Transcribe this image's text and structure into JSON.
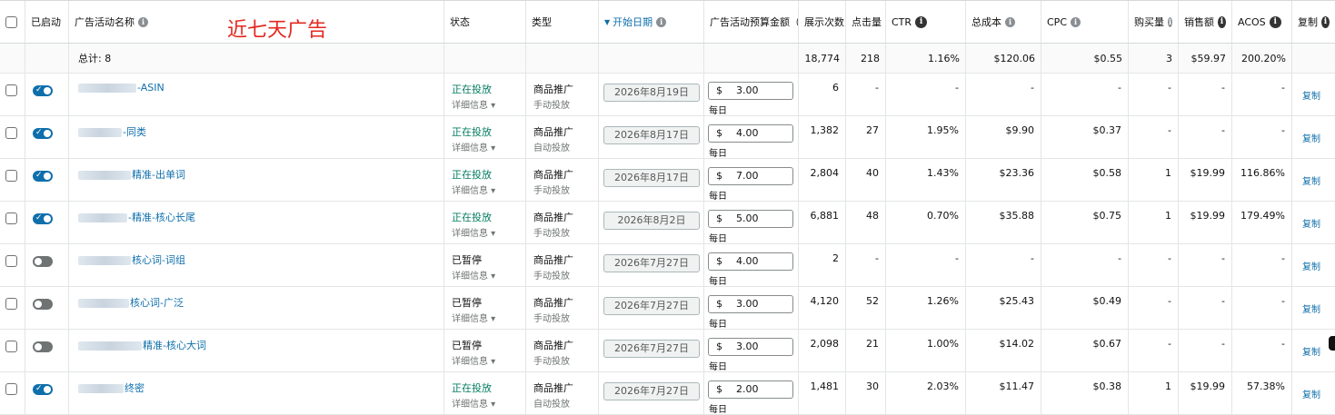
{
  "header": {
    "enabled": "已启动",
    "name": "广告活动名称",
    "status": "状态",
    "type": "类型",
    "start_date": "开始日期",
    "budget": "广告活动预算金额（",
    "impressions": "展示次数",
    "clicks": "点击量（",
    "ctr": "CTR",
    "cost": "总成本",
    "cpc": "CPC",
    "purchases": "购买量",
    "sales": "销售额",
    "acos": "ACOS",
    "copy": "复制"
  },
  "annotation": "近七天广告",
  "totals": {
    "label": "总计: 8",
    "impressions": "18,774",
    "clicks": "218",
    "ctr": "1.16%",
    "cost": "$120.06",
    "cpc": "$0.55",
    "purchases": "3",
    "sales": "$59.97",
    "acos": "200.20%"
  },
  "detail_label": "详细信息",
  "budget_currency": "$",
  "budget_period": "每日",
  "rows": [
    {
      "enabled": true,
      "name": "-ASIN",
      "status": "正在投放",
      "type": "商品推广",
      "targeting": "手动投放",
      "date": "2026年8月19日",
      "budget": "3.00",
      "impressions": "6",
      "clicks": "-",
      "ctr": "-",
      "cost": "-",
      "cpc": "-",
      "purchases": "-",
      "sales": "-",
      "acos": "-",
      "copy": "复制"
    },
    {
      "enabled": true,
      "name": "-同类",
      "status": "正在投放",
      "type": "商品推广",
      "targeting": "自动投放",
      "date": "2026年8月17日",
      "budget": "4.00",
      "impressions": "1,382",
      "clicks": "27",
      "ctr": "1.95%",
      "cost": "$9.90",
      "cpc": "$0.37",
      "purchases": "-",
      "sales": "-",
      "acos": "-",
      "copy": "复制"
    },
    {
      "enabled": true,
      "name": "精准-出单词",
      "status": "正在投放",
      "type": "商品推广",
      "targeting": "手动投放",
      "date": "2026年8月17日",
      "budget": "7.00",
      "impressions": "2,804",
      "clicks": "40",
      "ctr": "1.43%",
      "cost": "$23.36",
      "cpc": "$0.58",
      "purchases": "1",
      "sales": "$19.99",
      "acos": "116.86%",
      "copy": "复制"
    },
    {
      "enabled": true,
      "name": "-精准-核心长尾",
      "status": "正在投放",
      "type": "商品推广",
      "targeting": "手动投放",
      "date": "2026年8月2日",
      "budget": "5.00",
      "impressions": "6,881",
      "clicks": "48",
      "ctr": "0.70%",
      "cost": "$35.88",
      "cpc": "$0.75",
      "purchases": "1",
      "sales": "$19.99",
      "acos": "179.49%",
      "copy": "复制"
    },
    {
      "enabled": false,
      "name": "核心词-词组",
      "status": "已暂停",
      "type": "商品推广",
      "targeting": "手动投放",
      "date": "2026年7月27日",
      "budget": "4.00",
      "impressions": "2",
      "clicks": "-",
      "ctr": "-",
      "cost": "-",
      "cpc": "-",
      "purchases": "-",
      "sales": "-",
      "acos": "-",
      "copy": "复制"
    },
    {
      "enabled": false,
      "name": "核心词-广泛",
      "status": "已暂停",
      "type": "商品推广",
      "targeting": "手动投放",
      "date": "2026年7月27日",
      "budget": "3.00",
      "impressions": "4,120",
      "clicks": "52",
      "ctr": "1.26%",
      "cost": "$25.43",
      "cpc": "$0.49",
      "purchases": "-",
      "sales": "-",
      "acos": "-",
      "copy": "复制"
    },
    {
      "enabled": false,
      "name": "精准-核心大词",
      "status": "已暂停",
      "type": "商品推广",
      "targeting": "手动投放",
      "date": "2026年7月27日",
      "budget": "3.00",
      "impressions": "2,098",
      "clicks": "21",
      "ctr": "1.00%",
      "cost": "$14.02",
      "cpc": "$0.67",
      "purchases": "-",
      "sales": "-",
      "acos": "-",
      "copy": "复制"
    },
    {
      "enabled": true,
      "name": "终密",
      "status": "正在投放",
      "type": "商品推广",
      "targeting": "自动投放",
      "date": "2026年7月27日",
      "budget": "2.00",
      "impressions": "1,481",
      "clicks": "30",
      "ctr": "2.03%",
      "cost": "$11.47",
      "cpc": "$0.38",
      "purchases": "1",
      "sales": "$19.99",
      "acos": "57.38%",
      "copy": "复制"
    }
  ]
}
